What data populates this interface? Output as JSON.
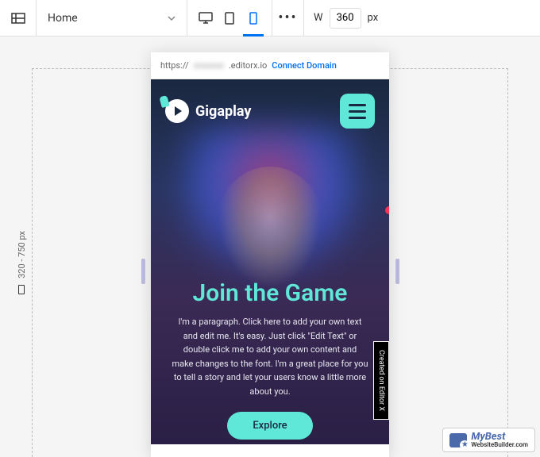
{
  "toolbar": {
    "page_label": "Home",
    "width_label": "W",
    "width_value": "360",
    "width_unit": "px",
    "more": "•••"
  },
  "ruler": {
    "range": "320 - 750 px"
  },
  "url_bar": {
    "prefix": "https://",
    "blurred": "xxxxxxx",
    "suffix": ".editorx.io",
    "connect": "Connect Domain"
  },
  "preview": {
    "brand": "Gigaplay",
    "title": "Join the Game",
    "body": "I'm a paragraph. Click here to add your own text and edit me. It's easy. Just click \"Edit Text\" or double click me to add your own content and make changes to the font. I'm a great place for you to tell a story and let your users know a little more about you.",
    "cta": "Explore",
    "side_badge": "Created on Editor X"
  },
  "watermark": {
    "line1": "MyBest",
    "line2": "WebsiteBuilder.com"
  }
}
